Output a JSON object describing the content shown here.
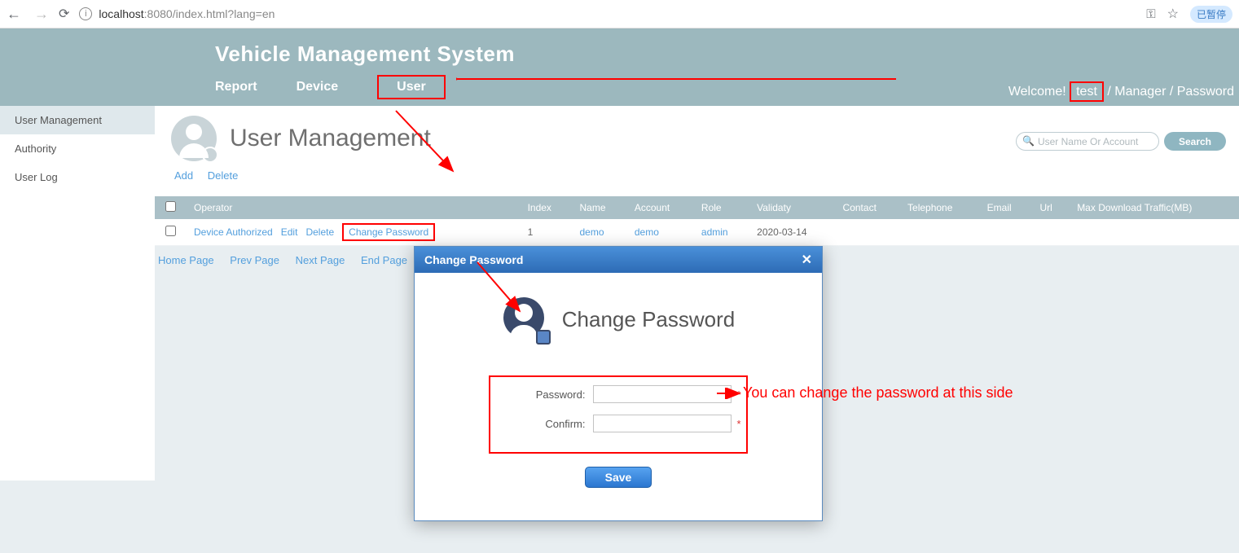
{
  "browser": {
    "url_host": "localhost",
    "url_port_path": ":8080/index.html?lang=en",
    "pause_label": "已暂停"
  },
  "header": {
    "app_title": "Vehicle Management System",
    "tabs": {
      "report": "Report",
      "device": "Device",
      "user": "User"
    },
    "welcome_prefix": "Welcome!  ",
    "username": "test",
    "sep": " / ",
    "role_label": "Manager",
    "pw_label": "Password"
  },
  "sidebar": {
    "items": [
      "User Management",
      "Authority",
      "User Log"
    ]
  },
  "page": {
    "title": "User Management",
    "search_placeholder": "User Name Or Account",
    "search_btn": "Search",
    "toolbar": {
      "add": "Add",
      "delete": "Delete"
    }
  },
  "table": {
    "cols": [
      "",
      "Operator",
      "",
      "Index",
      "Name",
      "Account",
      "Role",
      "Validaty",
      "Contact",
      "Telephone",
      "Email",
      "Url",
      "Max Download Traffic(MB)"
    ],
    "row": {
      "ops": {
        "device_auth": "Device Authorized",
        "edit": "Edit",
        "delete": "Delete",
        "chpw": "Change Password"
      },
      "index": "1",
      "name": "demo",
      "account": "demo",
      "role": "admin",
      "validity": "2020-03-14"
    }
  },
  "pager": {
    "home": "Home Page",
    "prev": "Prev Page",
    "next": "Next Page",
    "end": "End Page"
  },
  "dialog": {
    "titlebar": "Change Password",
    "heading": "Change Password",
    "pw_label": "Password:",
    "confirm_label": "Confirm:",
    "req": "*",
    "save": "Save"
  },
  "annotation": {
    "text": "You can change the password at this side"
  }
}
